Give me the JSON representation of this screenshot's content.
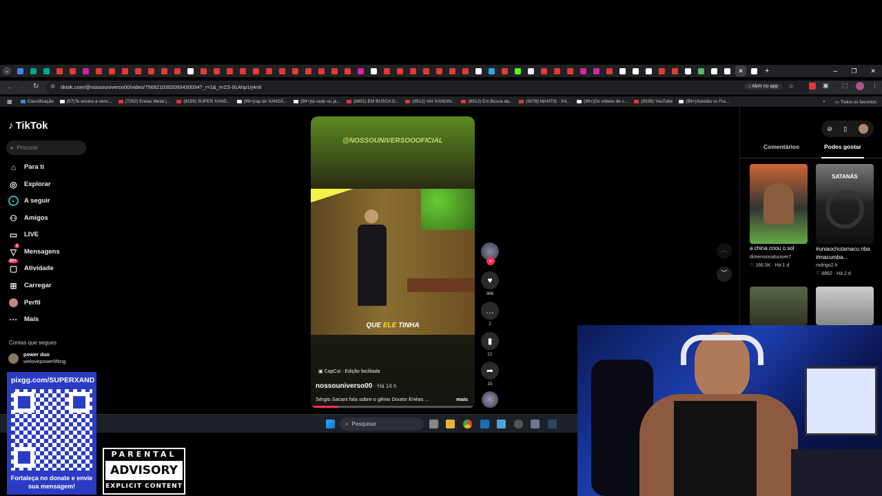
{
  "browser": {
    "url": "tiktok.com/@nossouniverso00/video/7569210302093430034?_r=1&_t=ZS-91Ahp1rj4n8",
    "open_app": "Abrir no app",
    "bookmarks": [
      "Classificação",
      "(57)Te ensino a venc...",
      "(7292) Enéas Metal |...",
      "(8159) SUPER XAND...",
      "(99+)rap do XANDÃ...",
      "(99+)tá cedo ou já...",
      "(8851) EM BUSCA D...",
      "(8912) VAI XANDIN...",
      "(8912) Em Busca da...",
      "(9078) MANTIS · XA...",
      "(99+)Os vídeos de c...",
      "(9338) YouTube",
      "(99+)Xandão vs Fra..."
    ],
    "all_favorites": "Todos os favoritos"
  },
  "tiktok": {
    "logo": "TikTok",
    "search_placeholder": "Procurar",
    "nav": [
      {
        "label": "Para ti",
        "icon": "home-icon"
      },
      {
        "label": "Explorar",
        "icon": "compass-icon"
      },
      {
        "label": "A seguir",
        "icon": "following-icon"
      },
      {
        "label": "Amigos",
        "icon": "friends-icon"
      },
      {
        "label": "LIVE",
        "icon": "live-icon"
      },
      {
        "label": "Mensagens",
        "icon": "messages-icon",
        "badge": "2"
      },
      {
        "label": "Atividade",
        "icon": "activity-icon",
        "badge": "99+"
      },
      {
        "label": "Carregar",
        "icon": "upload-icon"
      },
      {
        "label": "Perfil",
        "icon": "profile-icon"
      },
      {
        "label": "Mais",
        "icon": "more-icon"
      }
    ],
    "following_heading": "Contas que segues",
    "following": [
      {
        "name": "power duo",
        "handle": "welovepowerlifting"
      }
    ],
    "video": {
      "watermark": "@NOSSOUNIVERSOOOFICIAL",
      "caption_pre": "QUE ",
      "caption_hl": "ELE",
      "caption_post": " TINHA",
      "capcut": "CapCut · Edição facilitada",
      "author": "nossouniverso00",
      "time": "Há 14 h",
      "description": "Sérgio Sacani fala sobre o gênio Doutor Enéas ...",
      "more": "mais",
      "progress": 0.17
    },
    "actions": {
      "likes": "386",
      "comments": "2",
      "saves": "21",
      "shares": "15"
    },
    "right_tabs": [
      "Comentários",
      "Podes gostar"
    ],
    "suggestions": [
      {
        "title": "a china criou o sol",
        "author": "dimensionaluniver7",
        "likes": "166.5K",
        "time": "Há 1 d"
      },
      {
        "title": "#uniaochutamacu nba #macumba...",
        "author": "rodrigo2.h",
        "likes": "8862",
        "time": "Há 2 d",
        "overlay": "SATANÁS"
      }
    ]
  },
  "taskbar": {
    "search_placeholder": "Pesquisar"
  },
  "overlay": {
    "pix_url": "pixgg.com/SUPERXAND",
    "pix_text": "Fortaleça no donate e envie sua mensagem!",
    "pa_line1": "PARENTAL",
    "pa_line2": "ADVISORY",
    "pa_line3": "EXPLICIT CONTENT"
  },
  "colors": {
    "tiktok_red": "#fe2c55",
    "bg": "#000000",
    "pix_blue": "#2b3cc4"
  }
}
